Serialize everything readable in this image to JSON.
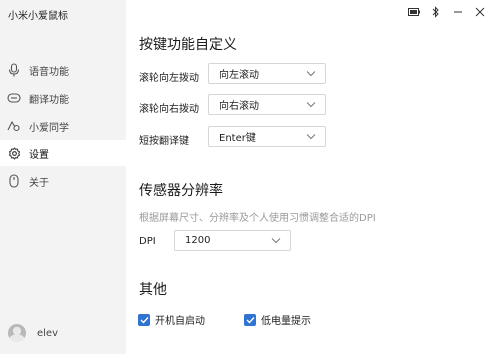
{
  "app": {
    "title": "小米小爱鼠标"
  },
  "sidebar": {
    "items": [
      {
        "label": "语音功能",
        "icon": "microphone-icon"
      },
      {
        "label": "翻译功能",
        "icon": "translate-icon"
      },
      {
        "label": "小爱同学",
        "icon": "xiaoai-icon"
      },
      {
        "label": "设置",
        "icon": "gear-icon",
        "active": true
      },
      {
        "label": "关于",
        "icon": "mouse-icon"
      }
    ],
    "user": {
      "name": "elev"
    }
  },
  "main": {
    "button_section": {
      "title": "按键功能自定义",
      "rows": [
        {
          "label": "滚轮向左拨动",
          "value": "向左滚动"
        },
        {
          "label": "滚轮向右拨动",
          "value": "向右滚动"
        },
        {
          "label": "短按翻译键",
          "value": "Enter键"
        }
      ]
    },
    "sensor_section": {
      "title": "传感器分辨率",
      "description": "根据屏幕尺寸、分辨率及个人使用习惯调整合适的DPI",
      "dpi_label": "DPI",
      "dpi_value": "1200"
    },
    "other_section": {
      "title": "其他",
      "options": [
        {
          "label": "开机自启动",
          "checked": true
        },
        {
          "label": "低电量提示",
          "checked": true
        }
      ]
    }
  },
  "colors": {
    "accent": "#2f74d0",
    "sidebar_bg": "#f3f3f3"
  }
}
